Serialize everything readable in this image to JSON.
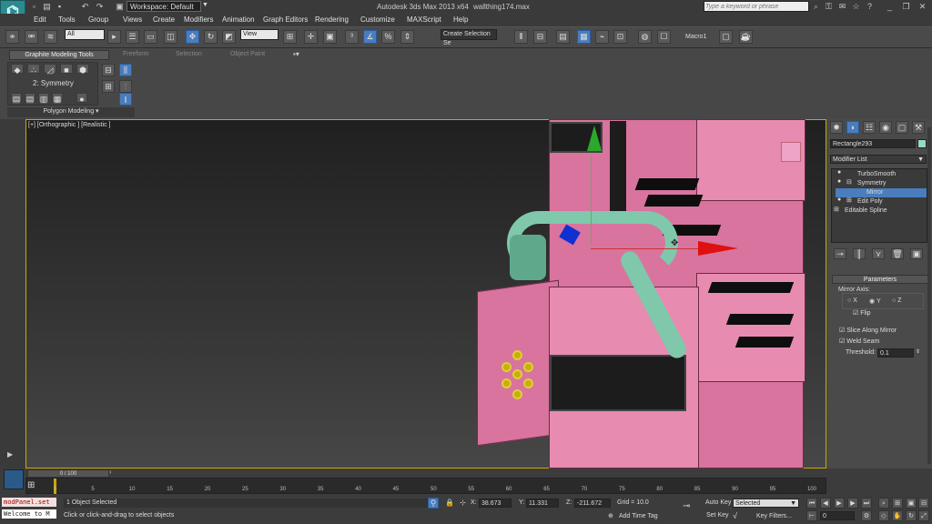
{
  "titlebar": {
    "title": "Autodesk 3ds Max  2013 x64",
    "filename": "wallthing174.max",
    "workspace": "Workspace: Default",
    "search_placeholder": "Type a keyword or phrase"
  },
  "menu": [
    "Edit",
    "Tools",
    "Group",
    "Views",
    "Create",
    "Modifiers",
    "Animation",
    "Graph Editors",
    "Rendering",
    "Customize",
    "MAXScript",
    "Help"
  ],
  "toolbar": {
    "filter": "All",
    "refcoord": "View",
    "selection_set": "Create Selection Se",
    "macro": "Macro1"
  },
  "ribbon": {
    "tabs": [
      "Graphite Modeling Tools",
      "Freeform",
      "Selection",
      "Object Paint"
    ],
    "active_tab": "Graphite Modeling Tools",
    "modifier_label": "2: Symmetry",
    "panel_label": "Polygon Modeling"
  },
  "viewport": {
    "label": "[+] [Orthographic ] [Realistic ]"
  },
  "command_panel": {
    "object_name": "Rectangle293",
    "object_color": "#9ad8c0",
    "modifier_list": "Modifier List",
    "stack": [
      {
        "label": "TurboSmooth",
        "selected": false
      },
      {
        "label": "Symmetry",
        "selected": false
      },
      {
        "label": "Mirror",
        "selected": true
      },
      {
        "label": "Edit Poly",
        "selected": false
      },
      {
        "label": "Editable Spline",
        "selected": false
      }
    ],
    "params_header": "Parameters",
    "mirror_axis_label": "Mirror Axis:",
    "axis": [
      "X",
      "Y",
      "Z"
    ],
    "selected_axis": "Y",
    "flip": "Flip",
    "slice": "Slice Along Mirror",
    "weld": "Weld Seam",
    "threshold_label": "Threshold:",
    "threshold_value": "0.1"
  },
  "timeline": {
    "frame_display": "0 / 100",
    "ticks": [
      "0",
      "5",
      "10",
      "15",
      "20",
      "25",
      "30",
      "35",
      "40",
      "45",
      "50",
      "55",
      "60",
      "65",
      "70",
      "75",
      "80",
      "85",
      "90",
      "95",
      "100"
    ]
  },
  "status": {
    "script_line1": "modPanel.set",
    "script_line2": "Welcome to M",
    "selected_text": "1 Object Selected",
    "prompt": "Click or click-and-drag to select objects",
    "x": "38.673",
    "y": "11.331",
    "z": "-211.672",
    "grid": "Grid = 10.0",
    "add_time_tag": "Add Time Tag",
    "auto_key": "Auto Key",
    "set_key": "Set Key",
    "selected_dropdown": "Selected",
    "key_filters": "Key Filters...",
    "frame": "0"
  },
  "colors": {
    "viewport_border": "#c8a800",
    "pink_geo": "#d8749e",
    "pipe": "#7fc8ac"
  }
}
